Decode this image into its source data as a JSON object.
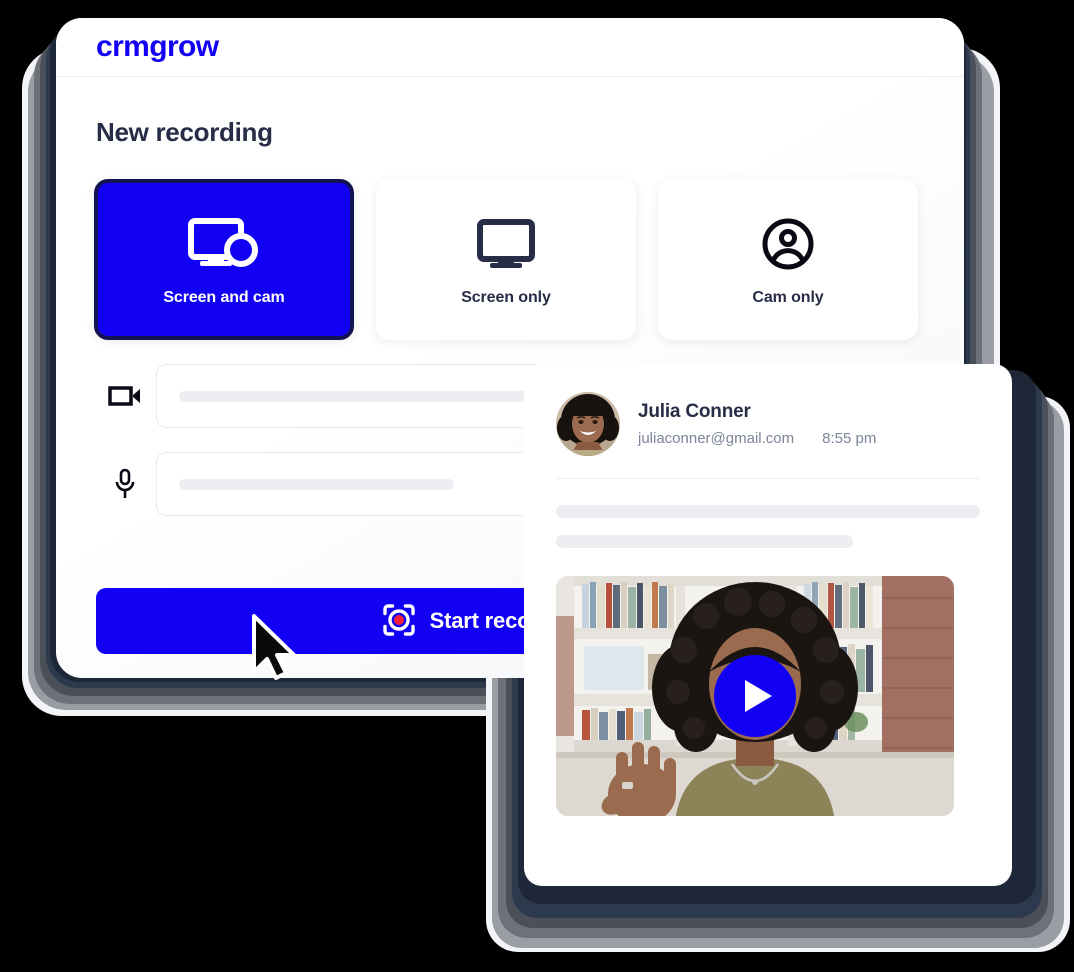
{
  "app": {
    "logo_text": "crmgrow",
    "logo_icon": "play-triangle-in-o",
    "accent_color": "#1200f5",
    "dark_color": "#272d47",
    "selected_border_color": "#141352",
    "record_dot_color": "#f11d3c"
  },
  "recorder": {
    "page_title": "New recording",
    "modes": [
      {
        "label": "Screen and cam",
        "icon": "screen-and-cam-icon",
        "selected": true
      },
      {
        "label": "Screen only",
        "icon": "monitor-icon",
        "selected": false
      },
      {
        "label": "Cam only",
        "icon": "account-circle-icon",
        "selected": false
      }
    ],
    "devices": [
      {
        "icon": "video-camera-icon",
        "name": "camera-select",
        "value": "",
        "placeholder": "",
        "bar_width_pct": 90
      },
      {
        "icon": "microphone-icon",
        "name": "microphone-select",
        "value": "",
        "placeholder": "",
        "bar_width_pct": 38
      }
    ],
    "start_button": {
      "label": "Start recording",
      "icon": "record-icon"
    },
    "cursor": "mouse-pointer"
  },
  "message": {
    "sender_name": "Julia Conner",
    "sender_email": "juliaconner@gmail.com",
    "time": "8:55 pm",
    "avatar_icon": "user-avatar-photo",
    "body_skeleton": [
      100,
      70
    ],
    "video": {
      "icon": "play-icon",
      "alt": "woman waving in front of bookshelf"
    }
  }
}
